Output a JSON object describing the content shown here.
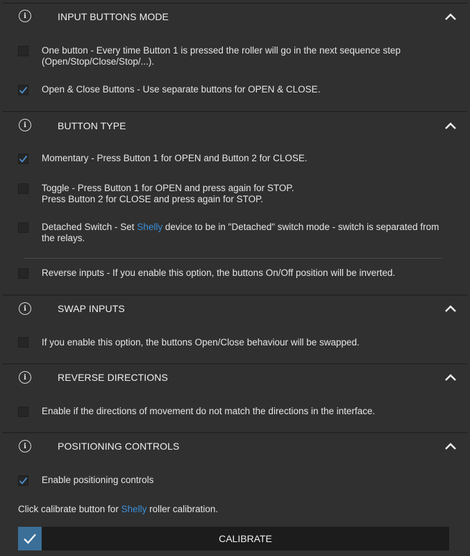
{
  "colors": {
    "background": "#303030",
    "accent": "#3a8fd8",
    "calibrate_check_bg": "#3b6f98",
    "button_bg": "#1c1c1c"
  },
  "sections": {
    "input_mode": {
      "title": "INPUT BUTTONS MODE",
      "options": {
        "one_button": {
          "checked": false,
          "line1": "One button - Every time Button 1 is pressed the roller will go in the next sequence step",
          "line2": "(Open/Stop/Close/Stop/...)."
        },
        "open_close": {
          "checked": true,
          "text": "Open & Close Buttons - Use separate buttons for OPEN & CLOSE."
        }
      }
    },
    "button_type": {
      "title": "BUTTON TYPE",
      "options": {
        "momentary": {
          "checked": true,
          "text": "Momentary - Press Button 1 for OPEN and Button 2 for CLOSE."
        },
        "toggle": {
          "checked": false,
          "line1": "Toggle - Press Button 1 for OPEN and press again for STOP.",
          "line2": "Press Button 2 for CLOSE and press again for STOP."
        },
        "detached": {
          "checked": false,
          "pre": "Detached Switch - Set ",
          "brand": "Shelly",
          "post": " device to be in \"Detached\" switch mode - switch is separated from",
          "line2": "the relays."
        },
        "reverse_inputs": {
          "checked": false,
          "text": "Reverse inputs - If you enable this option, the buttons On/Off position will be inverted."
        }
      }
    },
    "swap_inputs": {
      "title": "SWAP INPUTS",
      "option": {
        "checked": false,
        "text": "If you enable this option, the buttons Open/Close behaviour will be swapped."
      }
    },
    "reverse_directions": {
      "title": "REVERSE DIRECTIONS",
      "option": {
        "checked": false,
        "text": "Enable if the directions of movement do not match the directions in the interface."
      }
    },
    "positioning": {
      "title": "POSITIONING CONTROLS",
      "option": {
        "checked": true,
        "text": "Enable positioning controls"
      },
      "note_pre": "Click calibrate button for ",
      "note_brand": "Shelly",
      "note_post": " roller calibration.",
      "calibrate_label": "CALIBRATE"
    }
  },
  "icons": {
    "info": "info-icon",
    "collapse": "chevron-up-icon",
    "check": "checkmark-icon"
  },
  "info_glyph": "i"
}
